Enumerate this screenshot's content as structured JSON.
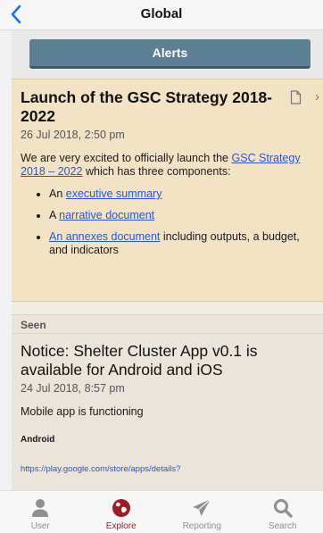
{
  "navbar": {
    "title": "Global"
  },
  "alerts_button": {
    "label": "Alerts"
  },
  "alert_card": {
    "title": "Launch of the GSC Strategy 2018-2022",
    "date": "26 Jul 2018, 2:50 pm",
    "intro_before": "We are very excited to officially launch the ",
    "intro_link": "GSC Strategy 2018 – 2022",
    "intro_after": " which has three components:",
    "bullets": [
      {
        "prefix": "An ",
        "link": "executive summary",
        "suffix": ""
      },
      {
        "prefix": "A ",
        "link": "narrative document",
        "suffix": ""
      },
      {
        "prefix": "",
        "link": "An annexes document",
        "suffix": " including outputs, a budget, and indicators"
      }
    ]
  },
  "seen_section": {
    "label": "Seen"
  },
  "notice_card": {
    "title": "Notice: Shelter Cluster App v0.1 is available for Android and iOS",
    "date": "24 Jul 2018, 8:57 pm",
    "text": "Mobile app is functioning",
    "subheading": "Android",
    "url": "https://play.google.com/store/apps/details?"
  },
  "tabbar": {
    "tabs": [
      {
        "label": "User",
        "icon": "user-icon"
      },
      {
        "label": "Explore",
        "icon": "globe-icon"
      },
      {
        "label": "Reporting",
        "icon": "paper-plane-icon"
      },
      {
        "label": "Search",
        "icon": "search-icon"
      }
    ],
    "active_color": "#9c1c2a",
    "inactive_color": "#8e8e93"
  }
}
